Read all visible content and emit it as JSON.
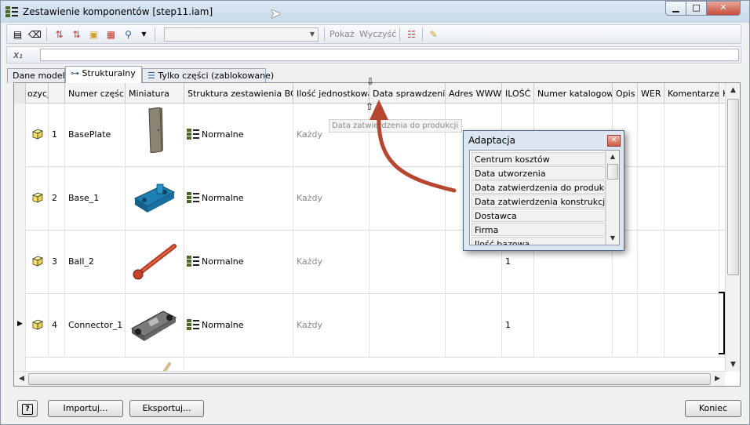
{
  "window": {
    "title": "Zestawienie komponentów [step11.iam]",
    "minimize": "▁",
    "maximize": "□",
    "close": "✕"
  },
  "toolbar": {
    "icons": [
      "view-icon",
      "eraser-icon",
      "sort-asc-icon",
      "sort-desc-icon",
      "item-icon",
      "renumber-icon",
      "find-icon",
      "dropdown-icon",
      "columns-icon",
      "customize-icon"
    ],
    "combo_value": "",
    "show_label": "Pokaż",
    "clear_label": "Wyczyść"
  },
  "formula": {
    "icon": "x₁",
    "value": ""
  },
  "tabs": [
    {
      "label": "Dane modelu",
      "active": false
    },
    {
      "label": "Strukturalny",
      "active": true
    },
    {
      "label": "Tylko części (zablokowane)",
      "active": false
    }
  ],
  "grid": {
    "columns": [
      "ozycja",
      "Numer części",
      "Miniatura",
      "Struktura zestawienia BOM",
      "Ilość jednostkowa",
      "Data sprawdzenia",
      "Adres WWW",
      "ILOŚĆ",
      "Numer katalogowy",
      "Opis",
      "WER",
      "Komentarze",
      "K"
    ],
    "rows": [
      {
        "num": "1",
        "part": "BasePlate",
        "bom": "Normalne",
        "unit": "Każdy",
        "qty": ""
      },
      {
        "num": "2",
        "part": "Base_1",
        "bom": "Normalne",
        "unit": "Każdy",
        "qty": ""
      },
      {
        "num": "3",
        "part": "Ball_2",
        "bom": "Normalne",
        "unit": "Każdy",
        "qty": "1"
      },
      {
        "num": "4",
        "part": "Connector_1",
        "bom": "Normalne",
        "unit": "Każdy",
        "qty": "1"
      }
    ],
    "drag_hint": "Data zatwierdzenia do produkcji"
  },
  "adaptation": {
    "title": "Adaptacja",
    "items": [
      "Centrum kosztów",
      "Data utworzenia",
      "Data zatwierdzenia do produkcji",
      "Data zatwierdzenia konstrukcji",
      "Dostawca",
      "Firma",
      "Ilość bazowa"
    ]
  },
  "buttons": {
    "help": "?",
    "import": "Importuj...",
    "export": "Eksportuj...",
    "close": "Koniec"
  },
  "colors": {
    "arrow": "#b5472f",
    "titlebar": "#c9daea",
    "close_button": "#c84c38"
  }
}
